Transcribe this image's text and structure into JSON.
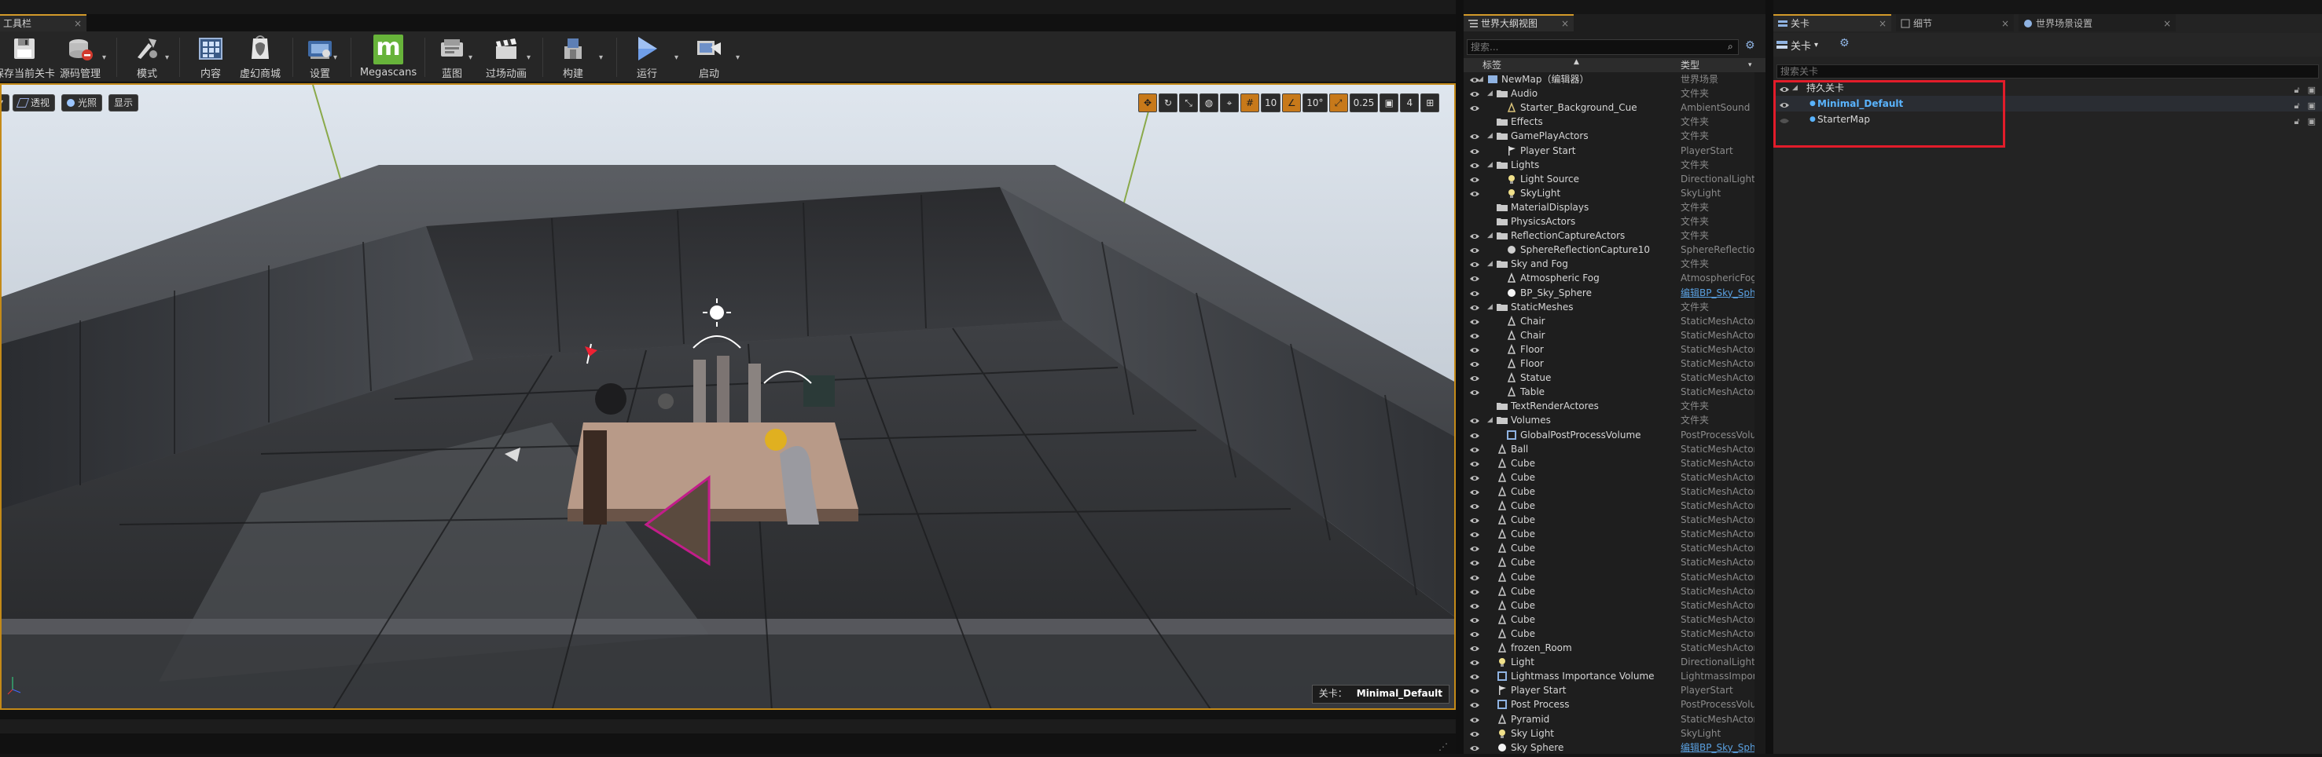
{
  "toolbar_tab": {
    "title": "工具栏"
  },
  "toolbar": {
    "buttons": [
      {
        "label": "保存当前关卡",
        "icon": "save-icon"
      },
      {
        "label": "源码管理",
        "icon": "source-control-icon"
      },
      {
        "label": "模式",
        "icon": "modes-icon"
      },
      {
        "label": "内容",
        "icon": "content-icon"
      },
      {
        "label": "虚幻商城",
        "icon": "marketplace-icon"
      },
      {
        "label": "设置",
        "icon": "settings-icon"
      },
      {
        "label": "Megascans",
        "icon": "megascans-icon"
      },
      {
        "label": "蓝图",
        "icon": "blueprint-icon"
      },
      {
        "label": "过场动画",
        "icon": "cinematics-icon"
      },
      {
        "label": "构建",
        "icon": "build-icon"
      },
      {
        "label": "运行",
        "icon": "play-icon"
      },
      {
        "label": "启动",
        "icon": "launch-icon"
      }
    ],
    "megascans_letter": "m"
  },
  "viewport": {
    "buttons": {
      "perspective": "透视",
      "lit": "光照",
      "show": "显示"
    },
    "grid_snap": "10",
    "rotation_snap": "10°",
    "scale_snap": "0.25",
    "camera_speed": "4",
    "level_label": "关卡：",
    "level_name": "Minimal_Default",
    "accent_color": "#c48a18"
  },
  "outliner": {
    "tab_title": "世界大纲视图",
    "search_placeholder": "搜索...",
    "col_label": "标签",
    "col_type": "类型",
    "rows": [
      {
        "name": "NewMap（编辑器）",
        "type": "世界场景",
        "depth": 0,
        "kind": "world",
        "eye": true,
        "expanded": true
      },
      {
        "name": "Audio",
        "type": "文件夹",
        "depth": 1,
        "kind": "folder",
        "eye": true,
        "expanded": true
      },
      {
        "name": "Starter_Background_Cue",
        "type": "AmbientSound",
        "depth": 2,
        "kind": "sound",
        "eye": true
      },
      {
        "name": "Effects",
        "type": "文件夹",
        "depth": 1,
        "kind": "folder",
        "eye": false
      },
      {
        "name": "GamePlayActors",
        "type": "文件夹",
        "depth": 1,
        "kind": "folder",
        "eye": true,
        "expanded": true
      },
      {
        "name": "Player Start",
        "type": "PlayerStart",
        "depth": 2,
        "kind": "flag",
        "eye": true
      },
      {
        "name": "Lights",
        "type": "文件夹",
        "depth": 1,
        "kind": "folder",
        "eye": true,
        "expanded": true
      },
      {
        "name": "Light Source",
        "type": "DirectionalLight",
        "depth": 2,
        "kind": "light",
        "eye": true
      },
      {
        "name": "SkyLight",
        "type": "SkyLight",
        "depth": 2,
        "kind": "light",
        "eye": true
      },
      {
        "name": "MaterialDisplays",
        "type": "文件夹",
        "depth": 1,
        "kind": "folder",
        "eye": false
      },
      {
        "name": "PhysicsActors",
        "type": "文件夹",
        "depth": 1,
        "kind": "folder",
        "eye": false
      },
      {
        "name": "ReflectionCaptureActors",
        "type": "文件夹",
        "depth": 1,
        "kind": "folder",
        "eye": true,
        "expanded": true
      },
      {
        "name": "SphereReflectionCapture10",
        "type": "SphereReflectionCa",
        "depth": 2,
        "kind": "sphere",
        "eye": true
      },
      {
        "name": "Sky and Fog",
        "type": "文件夹",
        "depth": 1,
        "kind": "folder",
        "eye": true,
        "expanded": true
      },
      {
        "name": "Atmospheric Fog",
        "type": "AtmosphericFog",
        "depth": 2,
        "kind": "fog",
        "eye": true
      },
      {
        "name": "BP_Sky_Sphere",
        "type": "编辑BP_Sky_Sphe",
        "depth": 2,
        "kind": "ball",
        "eye": true,
        "link": true
      },
      {
        "name": "StaticMeshes",
        "type": "文件夹",
        "depth": 1,
        "kind": "folder",
        "eye": true,
        "expanded": true
      },
      {
        "name": "Chair",
        "type": "StaticMeshActor",
        "depth": 2,
        "kind": "mesh",
        "eye": true
      },
      {
        "name": "Chair",
        "type": "StaticMeshActor",
        "depth": 2,
        "kind": "mesh",
        "eye": true
      },
      {
        "name": "Floor",
        "type": "StaticMeshActor",
        "depth": 2,
        "kind": "mesh",
        "eye": true
      },
      {
        "name": "Floor",
        "type": "StaticMeshActor",
        "depth": 2,
        "kind": "mesh",
        "eye": true
      },
      {
        "name": "Statue",
        "type": "StaticMeshActor",
        "depth": 2,
        "kind": "mesh",
        "eye": true
      },
      {
        "name": "Table",
        "type": "StaticMeshActor",
        "depth": 2,
        "kind": "mesh",
        "eye": true
      },
      {
        "name": "TextRenderActores",
        "type": "文件夹",
        "depth": 1,
        "kind": "folder",
        "eye": false
      },
      {
        "name": "Volumes",
        "type": "文件夹",
        "depth": 1,
        "kind": "folder",
        "eye": true,
        "expanded": true
      },
      {
        "name": "GlobalPostProcessVolume",
        "type": "PostProcessVolum",
        "depth": 2,
        "kind": "volume",
        "eye": true
      },
      {
        "name": "Ball",
        "type": "StaticMeshActor",
        "depth": 1,
        "kind": "mesh",
        "eye": true
      },
      {
        "name": "Cube",
        "type": "StaticMeshActor",
        "depth": 1,
        "kind": "mesh",
        "eye": true
      },
      {
        "name": "Cube",
        "type": "StaticMeshActor",
        "depth": 1,
        "kind": "mesh",
        "eye": true
      },
      {
        "name": "Cube",
        "type": "StaticMeshActor",
        "depth": 1,
        "kind": "mesh",
        "eye": true
      },
      {
        "name": "Cube",
        "type": "StaticMeshActor",
        "depth": 1,
        "kind": "mesh",
        "eye": true
      },
      {
        "name": "Cube",
        "type": "StaticMeshActor",
        "depth": 1,
        "kind": "mesh",
        "eye": true
      },
      {
        "name": "Cube",
        "type": "StaticMeshActor",
        "depth": 1,
        "kind": "mesh",
        "eye": true
      },
      {
        "name": "Cube",
        "type": "StaticMeshActor",
        "depth": 1,
        "kind": "mesh",
        "eye": true
      },
      {
        "name": "Cube",
        "type": "StaticMeshActor",
        "depth": 1,
        "kind": "mesh",
        "eye": true
      },
      {
        "name": "Cube",
        "type": "StaticMeshActor",
        "depth": 1,
        "kind": "mesh",
        "eye": true
      },
      {
        "name": "Cube",
        "type": "StaticMeshActor",
        "depth": 1,
        "kind": "mesh",
        "eye": true
      },
      {
        "name": "Cube",
        "type": "StaticMeshActor",
        "depth": 1,
        "kind": "mesh",
        "eye": true
      },
      {
        "name": "Cube",
        "type": "StaticMeshActor",
        "depth": 1,
        "kind": "mesh",
        "eye": true
      },
      {
        "name": "Cube",
        "type": "StaticMeshActor",
        "depth": 1,
        "kind": "mesh",
        "eye": true
      },
      {
        "name": "frozen_Room",
        "type": "StaticMeshActor",
        "depth": 1,
        "kind": "mesh",
        "eye": true
      },
      {
        "name": "Light",
        "type": "DirectionalLight",
        "depth": 1,
        "kind": "light",
        "eye": true
      },
      {
        "name": "Lightmass Importance Volume",
        "type": "LightmassImportar",
        "depth": 1,
        "kind": "volume",
        "eye": true
      },
      {
        "name": "Player Start",
        "type": "PlayerStart",
        "depth": 1,
        "kind": "flag",
        "eye": true
      },
      {
        "name": "Post Process",
        "type": "PostProcessVolum",
        "depth": 1,
        "kind": "volume",
        "eye": true
      },
      {
        "name": "Pyramid",
        "type": "StaticMeshActor",
        "depth": 1,
        "kind": "mesh",
        "eye": true
      },
      {
        "name": "Sky Light",
        "type": "SkyLight",
        "depth": 1,
        "kind": "light",
        "eye": true
      },
      {
        "name": "Sky Sphere",
        "type": "编辑BP_Sky_Sphe",
        "depth": 1,
        "kind": "ball",
        "eye": true,
        "link": true
      }
    ]
  },
  "levels": {
    "tabs": [
      "关卡",
      "细节",
      "世界场景设置"
    ],
    "toolbar_label": "关卡",
    "search_placeholder": "搜索关卡",
    "items": [
      {
        "name": "持久关卡",
        "kind": "persistent"
      },
      {
        "name": "Minimal_Default",
        "kind": "current"
      },
      {
        "name": "StarterMap",
        "kind": "sub"
      }
    ],
    "highlight_color": "#e21c2a",
    "current_color": "#5ab4ff"
  }
}
